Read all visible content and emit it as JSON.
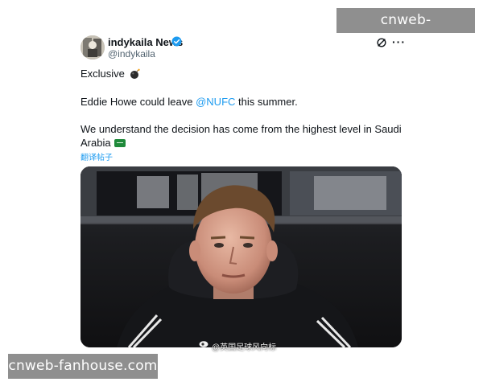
{
  "watermark": {
    "text": "cnweb-fanhouse.com"
  },
  "author": {
    "display_name": "indykaila News",
    "handle": "@indykaila",
    "verified": true,
    "verified_color": "#1d9bf0"
  },
  "header_actions": {
    "icons": [
      "grok-icon",
      "more-icon"
    ],
    "more_label": "···"
  },
  "tweet": {
    "line1": "Exclusive",
    "line2_prefix": "Eddie Howe could leave ",
    "line2_mention": "@NUFC",
    "line2_suffix": " this summer.",
    "line3": "We understand the decision has come from the highest level in Saudi",
    "line4": "Arabia",
    "translate_label": "翻译帖子",
    "emojis": [
      "bomb",
      "saudi-flag"
    ]
  },
  "media": {
    "credit": "@英国足球风向标",
    "alt_icons": [
      "weibo-icon"
    ]
  },
  "colors": {
    "link": "#1d9bf0",
    "text": "#0f1419",
    "muted": "#536471",
    "watermark_bg": "#8f8f8f"
  }
}
